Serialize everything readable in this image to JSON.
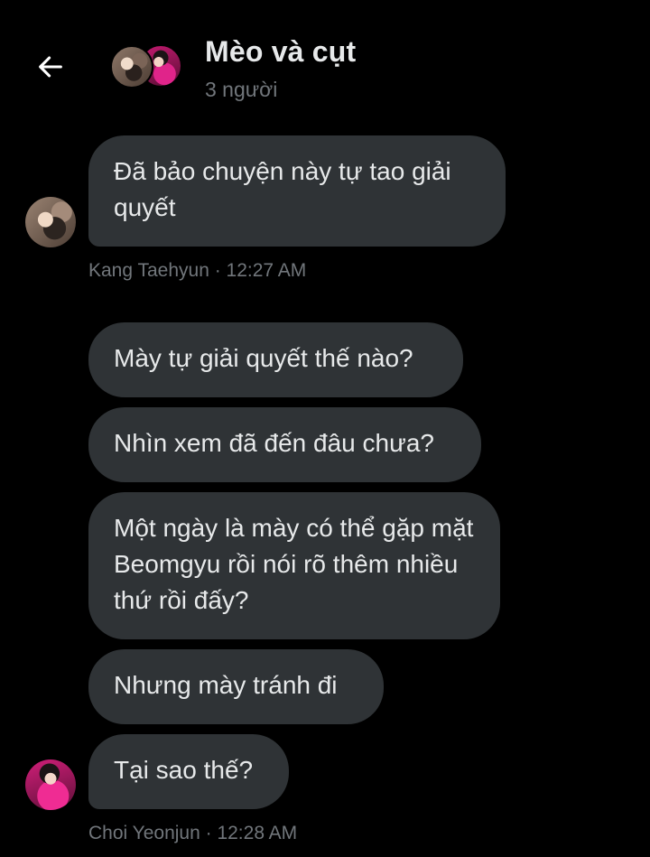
{
  "header": {
    "back_icon": "arrow-left-icon",
    "title": "Mèo và cụt",
    "subtitle": "3 người"
  },
  "colors": {
    "background": "#000000",
    "bubble": "#2f3336",
    "text": "#e7e9ea",
    "muted": "#71767b"
  },
  "messages": [
    {
      "text": "Đã bảo chuyện này tự tao giải quyết",
      "sender": "Kang Taehyun"
    },
    {
      "text": "Mày tự giải quyết thế nào?",
      "sender": "Choi Yeonjun"
    },
    {
      "text": "Nhìn xem đã đến đâu chưa?",
      "sender": "Choi Yeonjun"
    },
    {
      "text": "Một ngày là mày có thể gặp mặt Beomgyu rồi nói rõ thêm nhiều thứ rồi đấy?",
      "sender": "Choi Yeonjun"
    },
    {
      "text": "Nhưng mày tránh đi",
      "sender": "Choi Yeonjun"
    },
    {
      "text": "Tại sao thế?",
      "sender": "Choi Yeonjun"
    }
  ],
  "meta": [
    {
      "label": "Kang Taehyun · 12:27 AM"
    },
    {
      "label": "Choi Yeonjun · 12:28 AM"
    }
  ]
}
